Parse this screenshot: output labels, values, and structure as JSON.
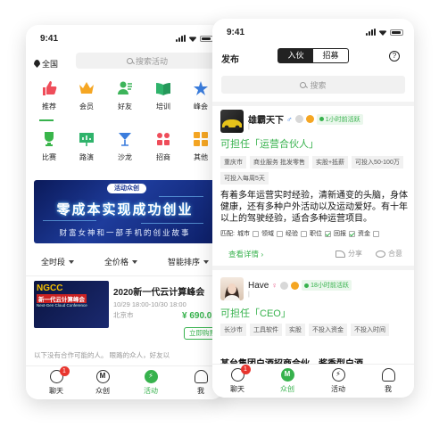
{
  "phone1": {
    "time": "9:41",
    "location": "全国",
    "search_placeholder": "搜索活动",
    "categories": [
      {
        "label": "推荐",
        "color": "#ef4d5a",
        "icon": "thumbs-up-icon"
      },
      {
        "label": "会员",
        "color": "#f5a623",
        "icon": "crown-icon"
      },
      {
        "label": "好友",
        "color": "#3db45a",
        "icon": "friend-icon"
      },
      {
        "label": "培训",
        "color": "#2fb36b",
        "icon": "book-icon"
      },
      {
        "label": "峰会",
        "color": "#3b7ddd",
        "icon": "star-icon"
      },
      {
        "label": "比赛",
        "color": "#39b54a",
        "icon": "trophy-icon"
      },
      {
        "label": "路演",
        "color": "#2fb36b",
        "icon": "presentation-icon"
      },
      {
        "label": "沙龙",
        "color": "#3b7ddd",
        "icon": "cocktail-icon"
      },
      {
        "label": "招商",
        "color": "#ef4d5a",
        "icon": "group-icon"
      },
      {
        "label": "其他",
        "color": "#f5a623",
        "icon": "grid-icon"
      }
    ],
    "banner": {
      "tag": "活动众创",
      "headline": "零成本实现成功创业",
      "subline": "财富女神和一部手机的创业故事"
    },
    "filters": [
      "全时段",
      "全价格",
      "智能排序"
    ],
    "event": {
      "logo_big": "NGCC",
      "logo_mid": "新一代云计算峰会",
      "logo_small": "Next-Gen Cloud Conference",
      "title": "2020新一代云计算峰会",
      "date": "10/29 18:00-10/30 18:00",
      "city": "北京市",
      "price": "¥ 690.0",
      "button": "立即购票"
    },
    "no_more": "以下没有合作可能的人。 眼路的众人，好友以",
    "tabs": [
      {
        "label": "聊天",
        "badge": "1",
        "glyph": ""
      },
      {
        "label": "众创",
        "badge": "",
        "glyph": "M"
      },
      {
        "label": "活动",
        "badge": "",
        "glyph": "⚡"
      },
      {
        "label": "我",
        "badge": "",
        "glyph": ""
      }
    ]
  },
  "phone2": {
    "time": "9:41",
    "publish": "发布",
    "seg": [
      "入伙",
      "招募"
    ],
    "help": "?",
    "search_placeholder": "搜索",
    "card1": {
      "name": "雄霸天下",
      "gender": "♂",
      "online": "1小时前活跃",
      "role": "可担任「运营合伙人」",
      "chips": [
        "重庆市",
        "商业服务 批发零售",
        "实股+抵薪",
        "可投入50-100万",
        "可投入每周5天"
      ],
      "desc": "有着多年运营实时经验，清新通变的头脑，身体健康，还有多种户外活动以及运动爱好。有十年以上的驾驶经验，适合多种运营项目。",
      "match_label": "匹配:",
      "match_items": [
        "城市",
        "领域",
        "经验",
        "职位",
        "回报",
        "资金"
      ],
      "more": "查看详情 ›",
      "share": "分享",
      "fit": "合意"
    },
    "card2": {
      "name": "Have",
      "gender": "♀",
      "online": "18小时前活跃",
      "role": "可担任「CEO」",
      "chips": [
        "长沙市",
        "工具软件",
        "实股",
        "不投入资金",
        "不投入时间"
      ],
      "desc": "某台集团白酒招商合伙，酱香型白酒"
    },
    "tabs": [
      {
        "label": "聊天",
        "badge": "1",
        "glyph": ""
      },
      {
        "label": "众创",
        "badge": "",
        "glyph": "M"
      },
      {
        "label": "活动",
        "badge": "",
        "glyph": "⚡"
      },
      {
        "label": "我",
        "badge": "",
        "glyph": ""
      }
    ]
  },
  "colors": {
    "accent": "#37b24d",
    "badge": "#e8352e"
  }
}
